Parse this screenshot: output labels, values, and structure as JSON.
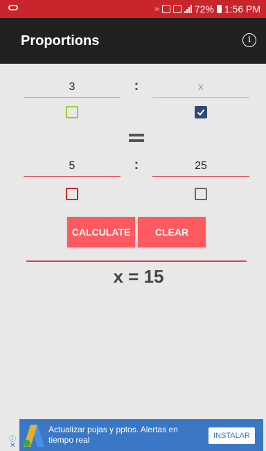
{
  "status_bar": {
    "battery": "72%",
    "time": "1:56 PM",
    "icons": [
      "voicemail-icon",
      "wifi-icon",
      "sim-icon",
      "signal-icon",
      "battery-icon"
    ]
  },
  "app_bar": {
    "title": "Proportions",
    "info_icon": "info-icon"
  },
  "proportion": {
    "a": "3",
    "x_placeholder": "x",
    "b": "5",
    "c": "25",
    "separator": ":"
  },
  "checkboxes": {
    "a_checked": false,
    "x_checked": true,
    "b_checked": false,
    "c_checked": false
  },
  "buttons": {
    "calculate": "CALCULATE",
    "clear": "CLEAR"
  },
  "result": "x = 15",
  "ad": {
    "text": "Actualizar pujas y pptos. Alertas en tiempo real",
    "button": "INSTALAR"
  },
  "colors": {
    "status_bar": "#c9262c",
    "app_bar": "#212121",
    "button": "#ff5a60",
    "green": "#9ccc3a",
    "red": "#e53a46",
    "checked": "#2c4a73",
    "ad": "#3a78c6"
  }
}
